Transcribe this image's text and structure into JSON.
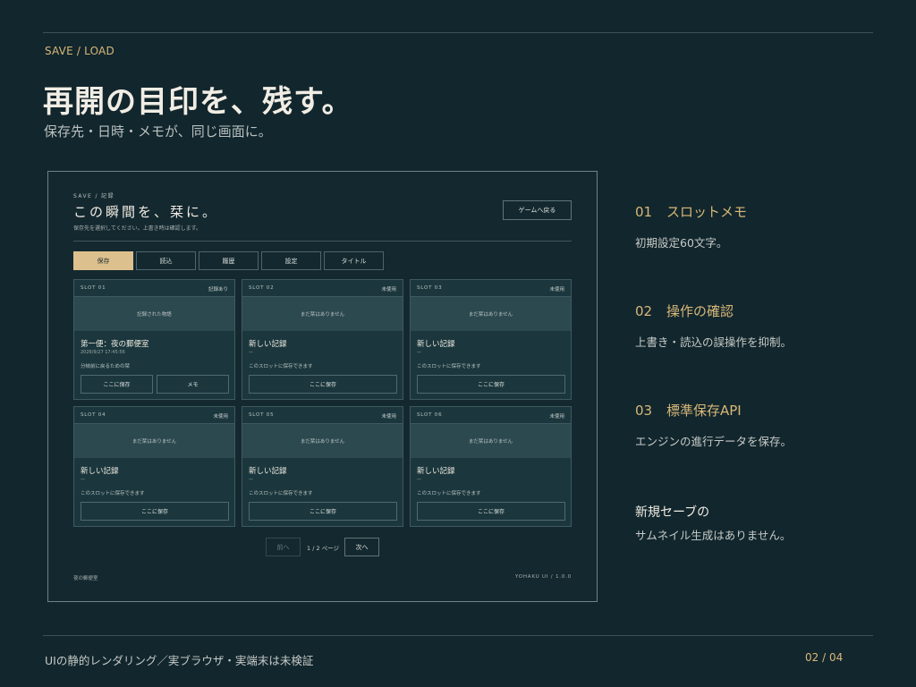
{
  "header": {
    "eyebrow": "SAVE / LOAD",
    "title": "再開の目印を、残す。",
    "subtitle": "保存先・日時・メモが、同じ画面に。"
  },
  "ui": {
    "eyebrow": "SAVE / 記録",
    "title": "この瞬間を、栞に。",
    "subtitle": "保存先を選択してください。上書き時は確認します。",
    "back_button": "ゲームへ戻る",
    "tabs": [
      {
        "label": "保存",
        "active": true
      },
      {
        "label": "読込",
        "active": false
      },
      {
        "label": "履歴",
        "active": false
      },
      {
        "label": "設定",
        "active": false
      },
      {
        "label": "タイトル",
        "active": false
      }
    ],
    "slots": [
      {
        "slot": "SLOT 01",
        "status": "記録あり",
        "thumb": "記録された物語",
        "title": "第一便：夜の郵便室",
        "date": "2026/9/27 17:45:56",
        "note": "分岐前に戻るための栞",
        "buttons": [
          "ここに保存",
          "メモ"
        ]
      },
      {
        "slot": "SLOT 02",
        "status": "未使用",
        "thumb": "まだ栞はありません",
        "title": "新しい記録",
        "date": "—",
        "note": "このスロットに保存できます",
        "buttons": [
          "ここに保存"
        ]
      },
      {
        "slot": "SLOT 03",
        "status": "未使用",
        "thumb": "まだ栞はありません",
        "title": "新しい記録",
        "date": "—",
        "note": "このスロットに保存できます",
        "buttons": [
          "ここに保存"
        ]
      },
      {
        "slot": "SLOT 04",
        "status": "未使用",
        "thumb": "まだ栞はありません",
        "title": "新しい記録",
        "date": "—",
        "note": "このスロットに保存できます",
        "buttons": [
          "ここに保存"
        ]
      },
      {
        "slot": "SLOT 05",
        "status": "未使用",
        "thumb": "まだ栞はありません",
        "title": "新しい記録",
        "date": "—",
        "note": "このスロットに保存できます",
        "buttons": [
          "ここに保存"
        ]
      },
      {
        "slot": "SLOT 06",
        "status": "未使用",
        "thumb": "まだ栞はありません",
        "title": "新しい記録",
        "date": "—",
        "note": "このスロットに保存できます",
        "buttons": [
          "ここに保存"
        ]
      }
    ],
    "pager": {
      "prev": "前へ",
      "info": "1 / 2 ページ",
      "next": "次へ"
    },
    "footer_left": "夜の郵便室",
    "footer_right": "YOHAKU UI / 1.0.0"
  },
  "features": [
    {
      "num": "01",
      "title": "スロットメモ",
      "body": "初期設定60文字。"
    },
    {
      "num": "02",
      "title": "操作の確認",
      "body": "上書き・読込の誤操作を抑制。"
    },
    {
      "num": "03",
      "title": "標準保存API",
      "body": "エンジンの進行データを保存。"
    }
  ],
  "note": {
    "title": "新規セーブの",
    "body": "サムネイル生成はありません。"
  },
  "footer": {
    "left": "UIの静的レンダリング／実ブラウザ・実端末は未検証",
    "page": "02 / 04"
  },
  "colors": {
    "background": "#12262d",
    "accent": "#d8b878",
    "tab_active": "#dcc08d"
  }
}
